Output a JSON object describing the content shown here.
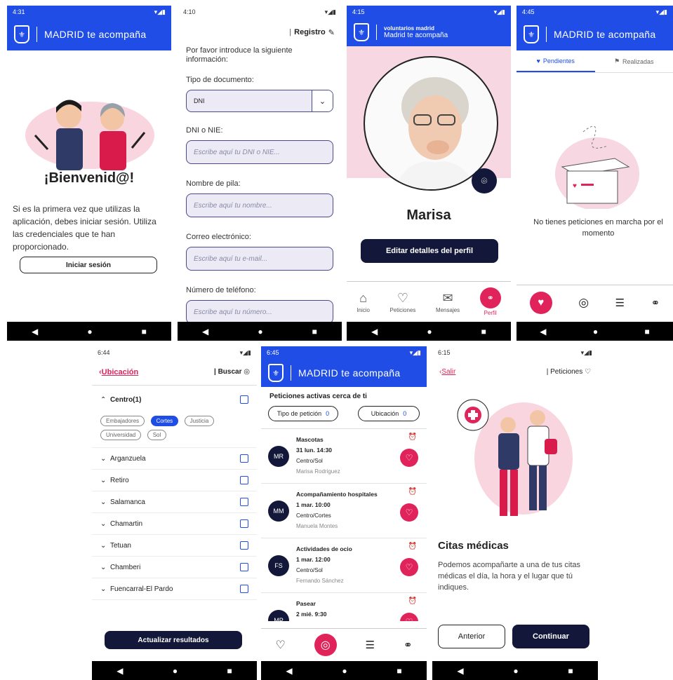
{
  "screens": {
    "welcome": {
      "time": "4:31",
      "app_title": "MADRID te acompaña",
      "heading": "¡Bienvenid@!",
      "body": "Si es la primera vez que utilizas la aplicación, debes iniciar sesión. Utiliza las credenciales que te han proporcionado.",
      "login_button": "Iniciar sesión"
    },
    "register": {
      "time": "4:10",
      "header_label": "Registro",
      "intro": "Por favor introduce la siguiente información:",
      "doc_type_label": "Tipo de documento:",
      "doc_type_value": "DNI",
      "dni_label": "DNI o NIE:",
      "dni_placeholder": "Escribe aquí tu DNI o NIE...",
      "name_label": "Nombre de pila:",
      "name_placeholder": "Escribe aquí tu nombre...",
      "email_label": "Correo electrónico:",
      "email_placeholder": "Escribe aquí tu e-mail...",
      "phone_label": "Número de teléfono:",
      "phone_placeholder": "Escribe aquí tu número..."
    },
    "profile": {
      "time": "4:15",
      "brand_top": "voluntarios madrid",
      "brand_sub": "Madrid te acompaña",
      "name": "Marisa",
      "edit_button": "Editar detalles del perfil",
      "tabs": [
        "Inicio",
        "Peticiones",
        "Mensajes",
        "Perfil"
      ]
    },
    "requests_empty": {
      "time": "4:45",
      "app_title": "MADRID te acompaña",
      "tab_pending": "Pendientes",
      "tab_done": "Realizadas",
      "empty_text": "No tienes peticiones en marcha por el momento"
    },
    "location": {
      "time": "6:44",
      "back_label": "Ubicación",
      "search_label": "Buscar",
      "expanded": "Centro(1)",
      "chips": [
        "Embajadores",
        "Cortes",
        "Justicia",
        "Universidad",
        "Sol"
      ],
      "districts": [
        "Arganzuela",
        "Retiro",
        "Salamanca",
        "Chamartin",
        "Tetuan",
        "Chamberi",
        "Fuencarral-El Pardo"
      ],
      "update_button": "Actualizar resultados"
    },
    "nearby": {
      "time": "6:45",
      "app_title": "MADRID te acompaña",
      "heading": "Peticiones activas cerca de ti",
      "filter_type": "Tipo de petición",
      "filter_type_count": "0",
      "filter_loc": "Ubicación",
      "filter_loc_count": "0",
      "items": [
        {
          "initials": "MR",
          "title": "Mascotas",
          "date": "31 lun. 14:30",
          "place": "Centro/Sol",
          "person": "Marisa Rodriguez"
        },
        {
          "initials": "MM",
          "title": "Acompañamiento hospitales",
          "date": "1 mar. 10:00",
          "place": "Centro/Cortes",
          "person": "Manuela Montes"
        },
        {
          "initials": "FS",
          "title": "Actividades de ocio",
          "date": "1 mar. 12:00",
          "place": "Centro/Sol",
          "person": "Fernando Sánchez"
        },
        {
          "initials": "MP",
          "title": "Pasear",
          "date": "2 mié. 9:30",
          "place": "",
          "person": ""
        }
      ]
    },
    "medical": {
      "time": "6:15",
      "back_label": "Salir",
      "header_label": "Peticiones",
      "title": "Citas médicas",
      "body": "Podemos acompañarte a una de tus citas médicas el día, la hora y el lugar que tú indiques.",
      "prev_button": "Anterior",
      "next_button": "Continuar"
    }
  },
  "colors": {
    "blue": "#1f4de6",
    "pink": "#e0235a",
    "navy": "#13183a"
  }
}
